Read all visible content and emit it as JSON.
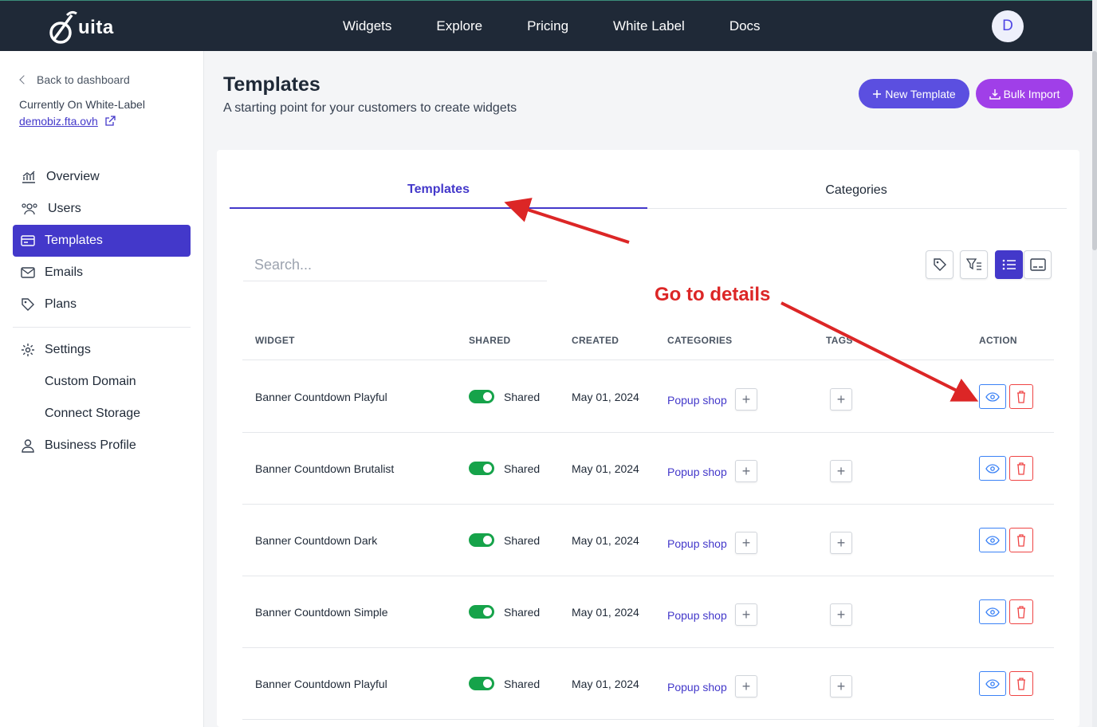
{
  "brand": {
    "name": "uita"
  },
  "nav": {
    "items": [
      "Widgets",
      "Explore",
      "Pricing",
      "White Label",
      "Docs"
    ]
  },
  "user": {
    "initial": "D"
  },
  "sidebar": {
    "back_label": "Back to dashboard",
    "current_label": "Currently On White-Label",
    "domain": "demobiz.fta.ovh",
    "items": [
      {
        "label": "Overview",
        "icon": "chart-icon"
      },
      {
        "label": "Users",
        "icon": "users-icon"
      },
      {
        "label": "Templates",
        "icon": "card-icon"
      },
      {
        "label": "Emails",
        "icon": "mail-icon"
      },
      {
        "label": "Plans",
        "icon": "tag-icon"
      }
    ],
    "settings": {
      "label": "Settings",
      "children": [
        "Custom Domain",
        "Connect Storage"
      ]
    },
    "business_profile": "Business Profile"
  },
  "header": {
    "title": "Templates",
    "subtitle": "A starting point for your customers to create widgets",
    "new_button": "New Template",
    "bulk_button": "Bulk Import"
  },
  "tabs": [
    "Templates",
    "Categories"
  ],
  "search": {
    "placeholder": "Search..."
  },
  "table": {
    "columns": [
      "WIDGET",
      "SHARED",
      "CREATED",
      "CATEGORIES",
      "TAGS",
      "ACTION"
    ],
    "rows": [
      {
        "widget": "Banner Countdown Playful",
        "shared": "Shared",
        "created": "May 01, 2024",
        "category": "Popup shop"
      },
      {
        "widget": "Banner Countdown Brutalist",
        "shared": "Shared",
        "created": "May 01, 2024",
        "category": "Popup shop"
      },
      {
        "widget": "Banner Countdown Dark",
        "shared": "Shared",
        "created": "May 01, 2024",
        "category": "Popup shop"
      },
      {
        "widget": "Banner Countdown Simple",
        "shared": "Shared",
        "created": "May 01, 2024",
        "category": "Popup shop"
      },
      {
        "widget": "Banner Countdown Playful",
        "shared": "Shared",
        "created": "May 01, 2024",
        "category": "Popup shop"
      }
    ]
  },
  "annotation": {
    "text": "Go to details"
  },
  "colors": {
    "accent": "#4338ca",
    "topbar": "#1f2937",
    "annotation": "#dc2626",
    "toggle_on": "#16a34a"
  }
}
